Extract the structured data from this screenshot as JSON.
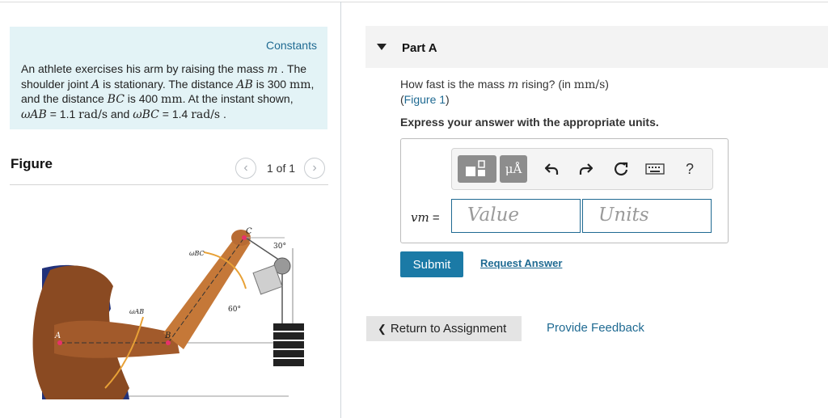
{
  "constants": {
    "link_label": "Constants",
    "problem": {
      "p1": "An athlete exercises his arm by raising the mass ",
      "mass_symbol": "m",
      "p2": " . The shoulder joint ",
      "joint_symbol": "A",
      "p3": " is stationary. The distance ",
      "ab_symbol": "AB",
      "p4": " is 300 ",
      "unit_mm_1": "mm",
      "p5": ", and the distance ",
      "bc_symbol": "BC",
      "p6": " is 400 ",
      "unit_mm_2": "mm",
      "p7": ". At the instant shown, ",
      "omega_ab": "ωAB",
      "p8": " = 1.1 ",
      "unit_rads_1": "rad/s",
      "p9": " and ",
      "omega_bc": "ωBC",
      "p10": " = 1.4 ",
      "unit_rads_2": "rad/s",
      "p11": " ."
    }
  },
  "figure": {
    "title": "Figure",
    "prev_icon": "‹",
    "next_icon": "›",
    "counter": "1 of 1",
    "labels": {
      "a": "A",
      "b": "B",
      "c": "C",
      "omega_ab": "ωAB",
      "omega_bc": "ωBC",
      "angle_30": "30°",
      "angle_60": "60°"
    }
  },
  "part": {
    "title": "Part A",
    "question_pre": "How fast is the mass ",
    "question_mass": "m",
    "question_mid": " rising? (in ",
    "question_unit": "mm/s",
    "question_post": ")",
    "figure_ref_open": "(",
    "figure_ref": "Figure 1",
    "figure_ref_close": ")",
    "instruction": "Express your answer with the appropriate units."
  },
  "answer": {
    "variable": "vm",
    "equals": "=",
    "value_placeholder": "Value",
    "units_placeholder": "Units",
    "toolbar": {
      "templates_icon": "templates-icon",
      "units_label": "μÅ",
      "undo_icon": "undo-icon",
      "redo_icon": "redo-icon",
      "reset_icon": "reset-icon",
      "keyboard_icon": "keyboard-icon",
      "help_label": "?"
    }
  },
  "actions": {
    "submit": "Submit",
    "request_answer": "Request Answer",
    "return": "Return to Assignment",
    "return_icon": "❮",
    "feedback": "Provide Feedback"
  },
  "colors": {
    "link": "#1f6a92",
    "submit_bg": "#1b7aa6",
    "constants_bg": "#e3f3f6",
    "header_bg": "#f3f3f3"
  }
}
